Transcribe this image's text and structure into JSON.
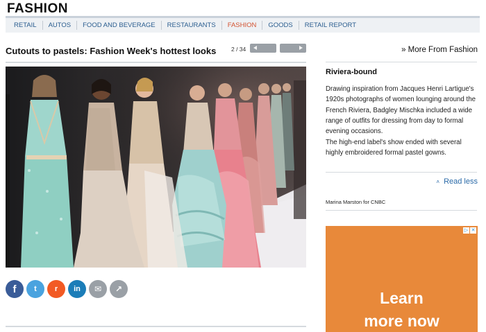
{
  "section": {
    "title": "FASHION"
  },
  "nav": {
    "items": [
      {
        "label": "RETAIL",
        "active": false
      },
      {
        "label": "AUTOS",
        "active": false
      },
      {
        "label": "FOOD AND BEVERAGE",
        "active": false
      },
      {
        "label": "RESTAURANTS",
        "active": false
      },
      {
        "label": "FASHION",
        "active": true
      },
      {
        "label": "GOODS",
        "active": false
      },
      {
        "label": "RETAIL REPORT",
        "active": false
      }
    ]
  },
  "gallery": {
    "title": "Cutouts to pastels: Fashion Week's hottest looks",
    "counter": "2 / 34",
    "prev_icon": "arrow-left-icon",
    "next_icon": "arrow-right-icon"
  },
  "more_link": "» More From Fashion",
  "caption": {
    "title": "Riviera-bound",
    "paragraph1": "Drawing inspiration from Jacques Henri Lartigue's 1920s photographs of women lounging around the French Riviera, Badgley Mischka included a wide range of outfits for dressing from day to formal evening occasions.",
    "paragraph2": "The high-end label's show ended with several highly embroidered formal pastel gowns.",
    "read_less": "Read less",
    "credit": "Marina Marston for CNBC"
  },
  "share": [
    {
      "name": "facebook",
      "glyph": "f",
      "color": "#3a5c98"
    },
    {
      "name": "twitter",
      "glyph": "t",
      "color": "#4aa3df"
    },
    {
      "name": "reddit",
      "glyph": "r",
      "color": "#f25a24"
    },
    {
      "name": "linkedin",
      "glyph": "in",
      "color": "#1b7db8"
    },
    {
      "name": "email",
      "glyph": "✉",
      "color": "#9aa0a6"
    },
    {
      "name": "share",
      "glyph": "↗",
      "color": "#9aa0a6"
    }
  ],
  "ad": {
    "cta_line1": "Learn",
    "cta_line2": "more now",
    "background": "#e8893a"
  },
  "colors": {
    "nav_link": "#2a5d8f",
    "nav_active": "#d35230",
    "read_less": "#2a6aa8"
  }
}
